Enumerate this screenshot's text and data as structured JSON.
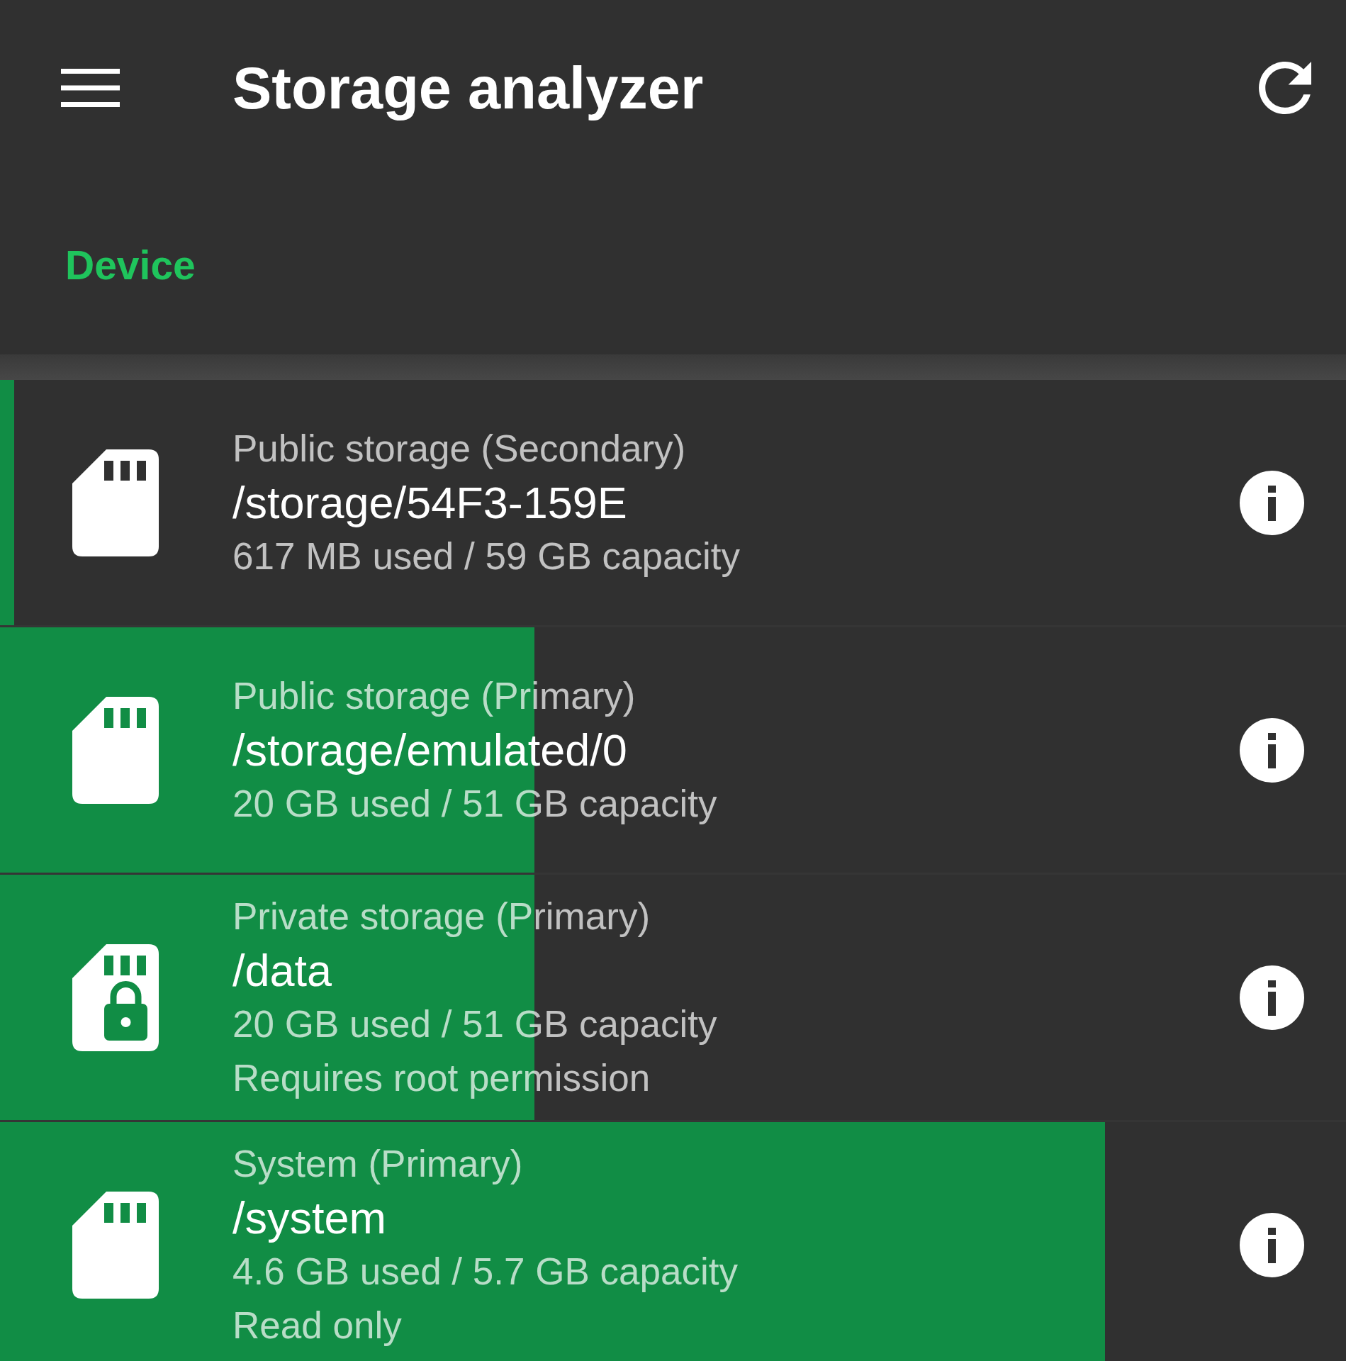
{
  "app_bar": {
    "title": "Storage analyzer"
  },
  "tabs": [
    {
      "label": "Device",
      "selected": true
    }
  ],
  "volumes": [
    {
      "title": "Public storage (Secondary)",
      "path": "/storage/54F3-159E",
      "usage": "617 MB used / 59 GB capacity",
      "level": 0.0105,
      "locked": false
    },
    {
      "title": "Public storage (Primary)",
      "path": "/storage/emulated/0",
      "usage": "20 GB used / 51 GB capacity",
      "level": 0.397,
      "locked": false
    },
    {
      "title": "Private storage (Primary)",
      "path": "/data",
      "usage": "20 GB used / 51 GB capacity",
      "note": "Requires root permission",
      "level": 0.397,
      "locked": true
    },
    {
      "title": "System (Primary)",
      "path": "/system",
      "usage": "4.6 GB used / 5.7 GB capacity",
      "note": "Read only",
      "level": 0.821,
      "locked": false
    }
  ]
}
